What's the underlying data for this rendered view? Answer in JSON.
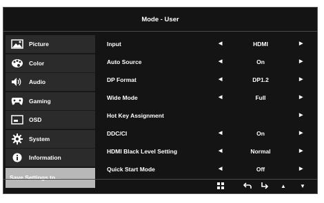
{
  "header": {
    "title": "Mode - User"
  },
  "sidebar": {
    "items": [
      {
        "label": "Picture",
        "icon": "picture-icon"
      },
      {
        "label": "Color",
        "icon": "palette-icon"
      },
      {
        "label": "Audio",
        "icon": "speaker-icon"
      },
      {
        "label": "Gaming",
        "icon": "gamepad-icon"
      },
      {
        "label": "OSD",
        "icon": "monitor-icon"
      },
      {
        "label": "System",
        "icon": "gear-icon"
      },
      {
        "label": "Information",
        "icon": "info-icon"
      },
      {
        "label": "Save Settings to..."
      }
    ],
    "selected_index": 7
  },
  "settings": [
    {
      "label": "Input",
      "value": "HDMI"
    },
    {
      "label": "Auto Source",
      "value": "On"
    },
    {
      "label": "DP Format",
      "value": "DP1.2"
    },
    {
      "label": "Wide Mode",
      "value": "Full"
    },
    {
      "label": "Hot Key Assignment",
      "value": ""
    },
    {
      "label": "DDC/CI",
      "value": "On"
    },
    {
      "label": "HDMI Black Level Setting",
      "value": "Normal"
    },
    {
      "label": "Quick Start Mode",
      "value": "Off"
    }
  ],
  "footer": {
    "icons": [
      "menu-grid-icon",
      "back-icon",
      "enter-icon",
      "up-icon",
      "down-icon"
    ]
  },
  "colors": {
    "background": "#141414",
    "selected": "#b8b8b8",
    "item": "#2b2b2b"
  }
}
